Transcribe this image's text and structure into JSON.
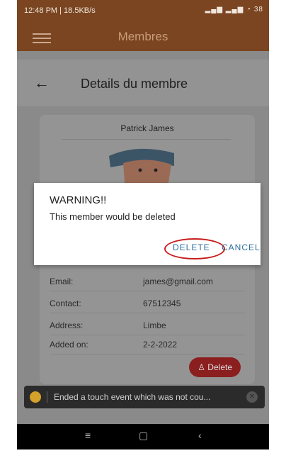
{
  "status_bar": {
    "time": "12:48 PM | 18.5KB/s",
    "signal": "▂▄▆ ▂▄▆ ◔ 38"
  },
  "app_bar": {
    "title": "Membres"
  },
  "page_header": {
    "title": "Details du membre"
  },
  "member": {
    "name": "Patrick James",
    "details": [
      {
        "label": "Email:",
        "value": "james@gmail.com"
      },
      {
        "label": "Contact:",
        "value": "67512345"
      },
      {
        "label": "Address:",
        "value": "Limbe"
      },
      {
        "label": "Added on:",
        "value": "2-2-2022"
      }
    ],
    "delete_label": "♙ Delete"
  },
  "dialog": {
    "title": "WARNING!!",
    "message": "This member would be deleted",
    "delete_label": "DELETE",
    "cancel_label": "CANCEL"
  },
  "toast": {
    "message": "Ended a touch event which was not cou..."
  },
  "nav_bar": {
    "menu": "≡",
    "home": "▢",
    "back": "‹"
  }
}
